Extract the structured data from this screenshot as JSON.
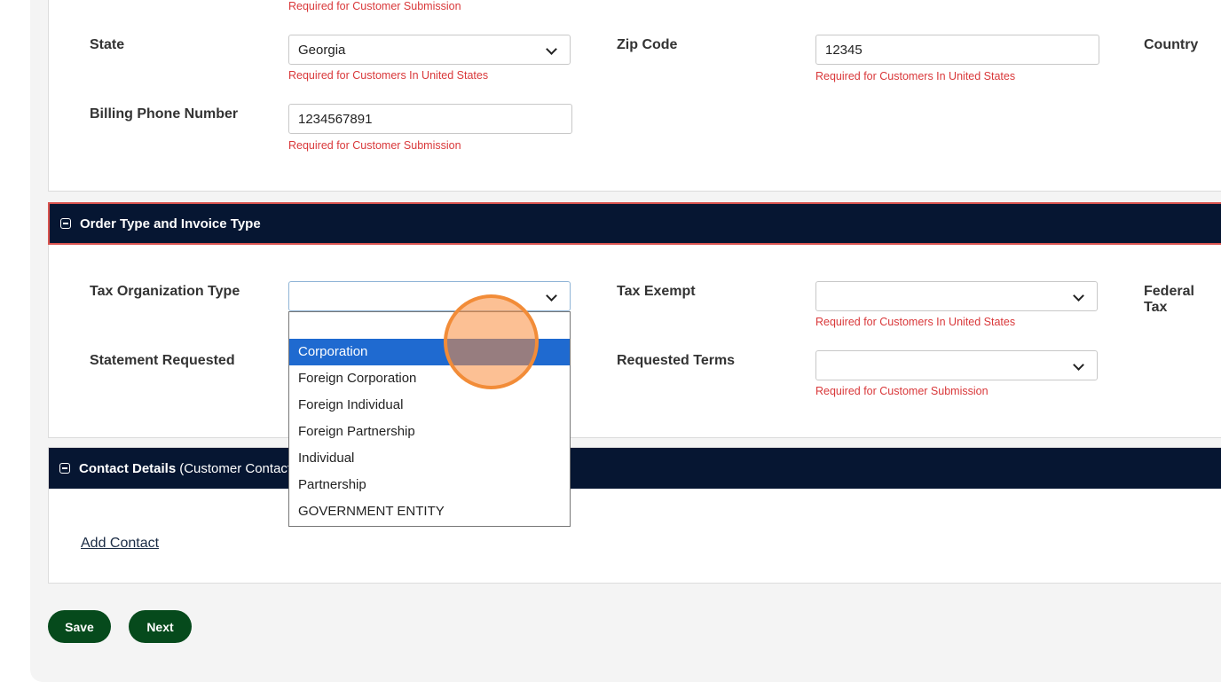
{
  "billing": {
    "top_required": "Required for Customer Submission",
    "state_label": "State",
    "state_value": "Georgia",
    "state_required": "Required for Customers In United States",
    "zip_label": "Zip Code",
    "zip_value": "12345",
    "zip_required": "Required for Customers In United States",
    "country_label": "Country",
    "phone_label": "Billing Phone Number",
    "phone_value": "1234567891",
    "phone_required": "Required for Customer Submission"
  },
  "order_section": {
    "title": "Order Type and Invoice Type",
    "tax_org_label": "Tax Organization Type",
    "tax_org_value": "",
    "tax_exempt_label": "Tax Exempt",
    "tax_exempt_value": "",
    "tax_exempt_required": "Required for Customers In United States",
    "federal_tax_label": "Federal Tax",
    "statement_label": "Statement Requested",
    "terms_label": "Requested Terms",
    "terms_value": "",
    "terms_required": "Required for Customer Submission",
    "dropdown_options": [
      "",
      "Corporation",
      "Foreign Corporation",
      "Foreign Individual",
      "Foreign Partnership",
      "Individual",
      "Partnership",
      "GOVERNMENT ENTITY"
    ],
    "dropdown_selected": "Corporation"
  },
  "contact_section": {
    "title_bold": "Contact Details",
    "title_rest": "(Customer Contact",
    "add_contact": "Add Contact"
  },
  "actions": {
    "save": "Save",
    "next": "Next"
  }
}
